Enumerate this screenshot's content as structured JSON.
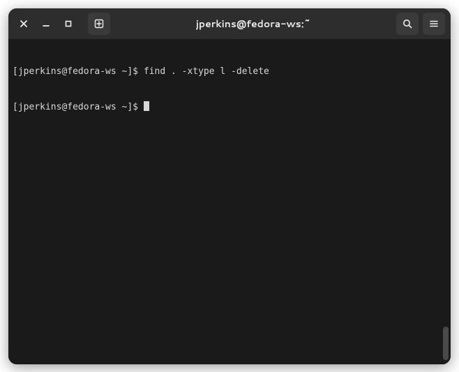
{
  "window": {
    "title": "jperkins@fedora-ws:~"
  },
  "terminal": {
    "lines": [
      {
        "prompt": "[jperkins@fedora-ws ~]$ ",
        "command": "find . -xtype l -delete"
      },
      {
        "prompt": "[jperkins@fedora-ws ~]$ ",
        "command": ""
      }
    ]
  }
}
